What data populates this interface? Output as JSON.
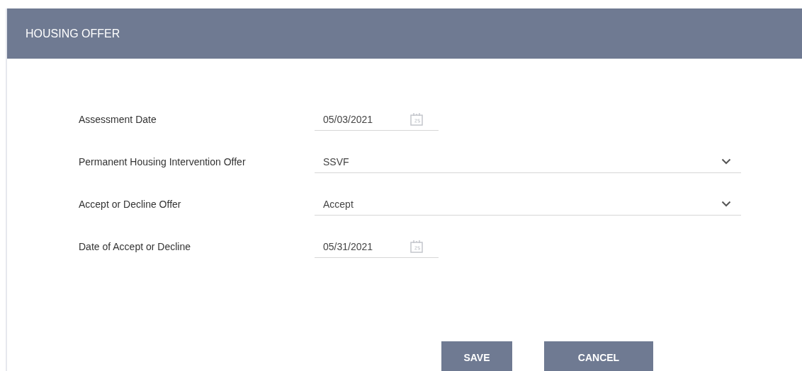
{
  "header": {
    "title": "HOUSING OFFER"
  },
  "fields": [
    {
      "label": "Assessment Date",
      "kind": "date",
      "value": "05/03/2021"
    },
    {
      "label": "Permanent Housing Intervention Offer",
      "kind": "select",
      "value": "SSVF"
    },
    {
      "label": "Accept or Decline Offer",
      "kind": "select",
      "value": "Accept"
    },
    {
      "label": "Date of Accept or Decline",
      "kind": "date",
      "value": "05/31/2021"
    }
  ],
  "buttons": [
    "SAVE",
    "CANCEL"
  ]
}
